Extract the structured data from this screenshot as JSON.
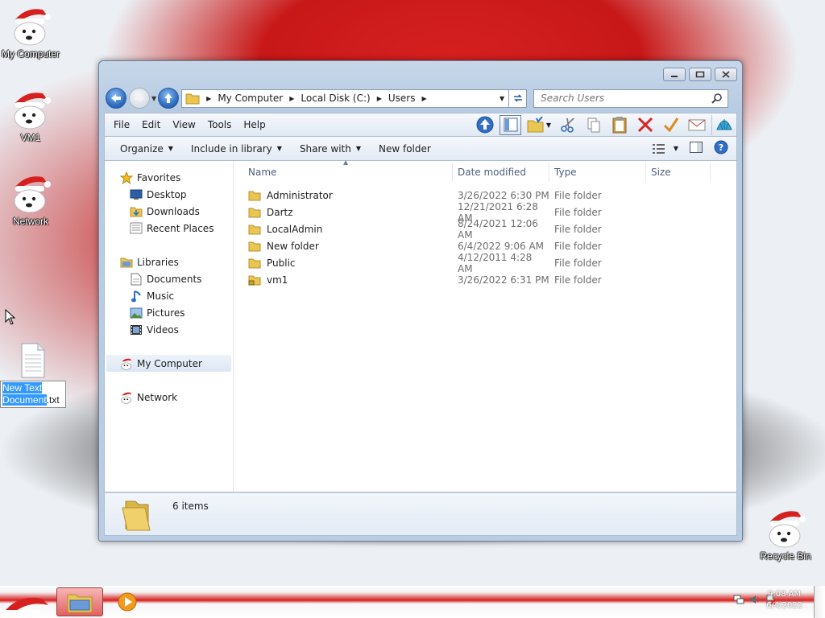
{
  "desktop": {
    "icons": [
      {
        "label": "My Computer"
      },
      {
        "label": "VM1"
      },
      {
        "label": "Network"
      },
      {
        "label": "Recycle Bin"
      }
    ],
    "text_file": {
      "label_selected": "New Text Document",
      "label_ext": ".txt"
    }
  },
  "window": {
    "address": {
      "segments": [
        "My Computer",
        "Local Disk (C:)",
        "Users"
      ]
    },
    "search": {
      "placeholder": "Search Users"
    },
    "menu": [
      "File",
      "Edit",
      "View",
      "Tools",
      "Help"
    ],
    "commands": {
      "organize": "Organize",
      "include_in_library": "Include in library",
      "share_with": "Share with",
      "new_folder": "New folder"
    },
    "nav": {
      "favorites": "Favorites",
      "favorites_items": [
        "Desktop",
        "Downloads",
        "Recent Places"
      ],
      "libraries": "Libraries",
      "libraries_items": [
        "Documents",
        "Music",
        "Pictures",
        "Videos"
      ],
      "my_computer": "My Computer",
      "network": "Network"
    },
    "columns": {
      "name": "Name",
      "date": "Date modified",
      "type": "Type",
      "size": "Size"
    },
    "files": [
      {
        "name": "Administrator",
        "date": "3/26/2022 6:30 PM",
        "type": "File folder"
      },
      {
        "name": "Dartz",
        "date": "12/21/2021 6:28 AM",
        "type": "File folder"
      },
      {
        "name": "LocalAdmin",
        "date": "8/24/2021 12:06 AM",
        "type": "File folder"
      },
      {
        "name": "New folder",
        "date": "6/4/2022 9:06 AM",
        "type": "File folder"
      },
      {
        "name": "Public",
        "date": "4/12/2011 4:28 AM",
        "type": "File folder"
      },
      {
        "name": "vm1",
        "date": "3/26/2022 6:31 PM",
        "type": "File folder"
      }
    ],
    "status": {
      "item_count": "6 items"
    }
  },
  "taskbar": {
    "clock_time": "9:08 AM",
    "clock_date": "6/4/2022"
  },
  "colors": {
    "selection": "#3399ff",
    "hat_red": "#d62020"
  }
}
